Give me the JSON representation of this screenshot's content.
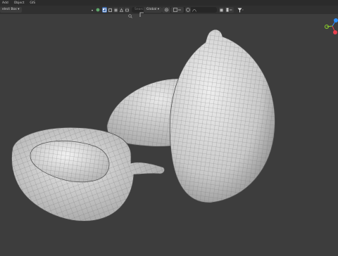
{
  "menu": {
    "items": [
      "Add",
      "Object",
      "GIS"
    ]
  },
  "header": {
    "select_mode": "elect Box ▾",
    "transform_orientation": "Global ▾",
    "search_placeholder": "Search"
  },
  "colors": {
    "menubar_bg": "#2b2b2b",
    "header_bg": "#303030",
    "viewport_bg": "#3d3d3d",
    "accent_active": "#4772b3",
    "gizmo_x": "#e8404e",
    "gizmo_y": "#8bd02a",
    "gizmo_z": "#2c8fff"
  },
  "icons": [
    "select-box-icon",
    "vertex-mode-icon",
    "edge-mode-icon",
    "face-mode-icon",
    "search-icon",
    "orientation-icon",
    "pivot-icon",
    "snap-icon",
    "proportional-edit-icon",
    "overlay-icon",
    "filter-icon",
    "axis-gizmo-icon"
  ]
}
